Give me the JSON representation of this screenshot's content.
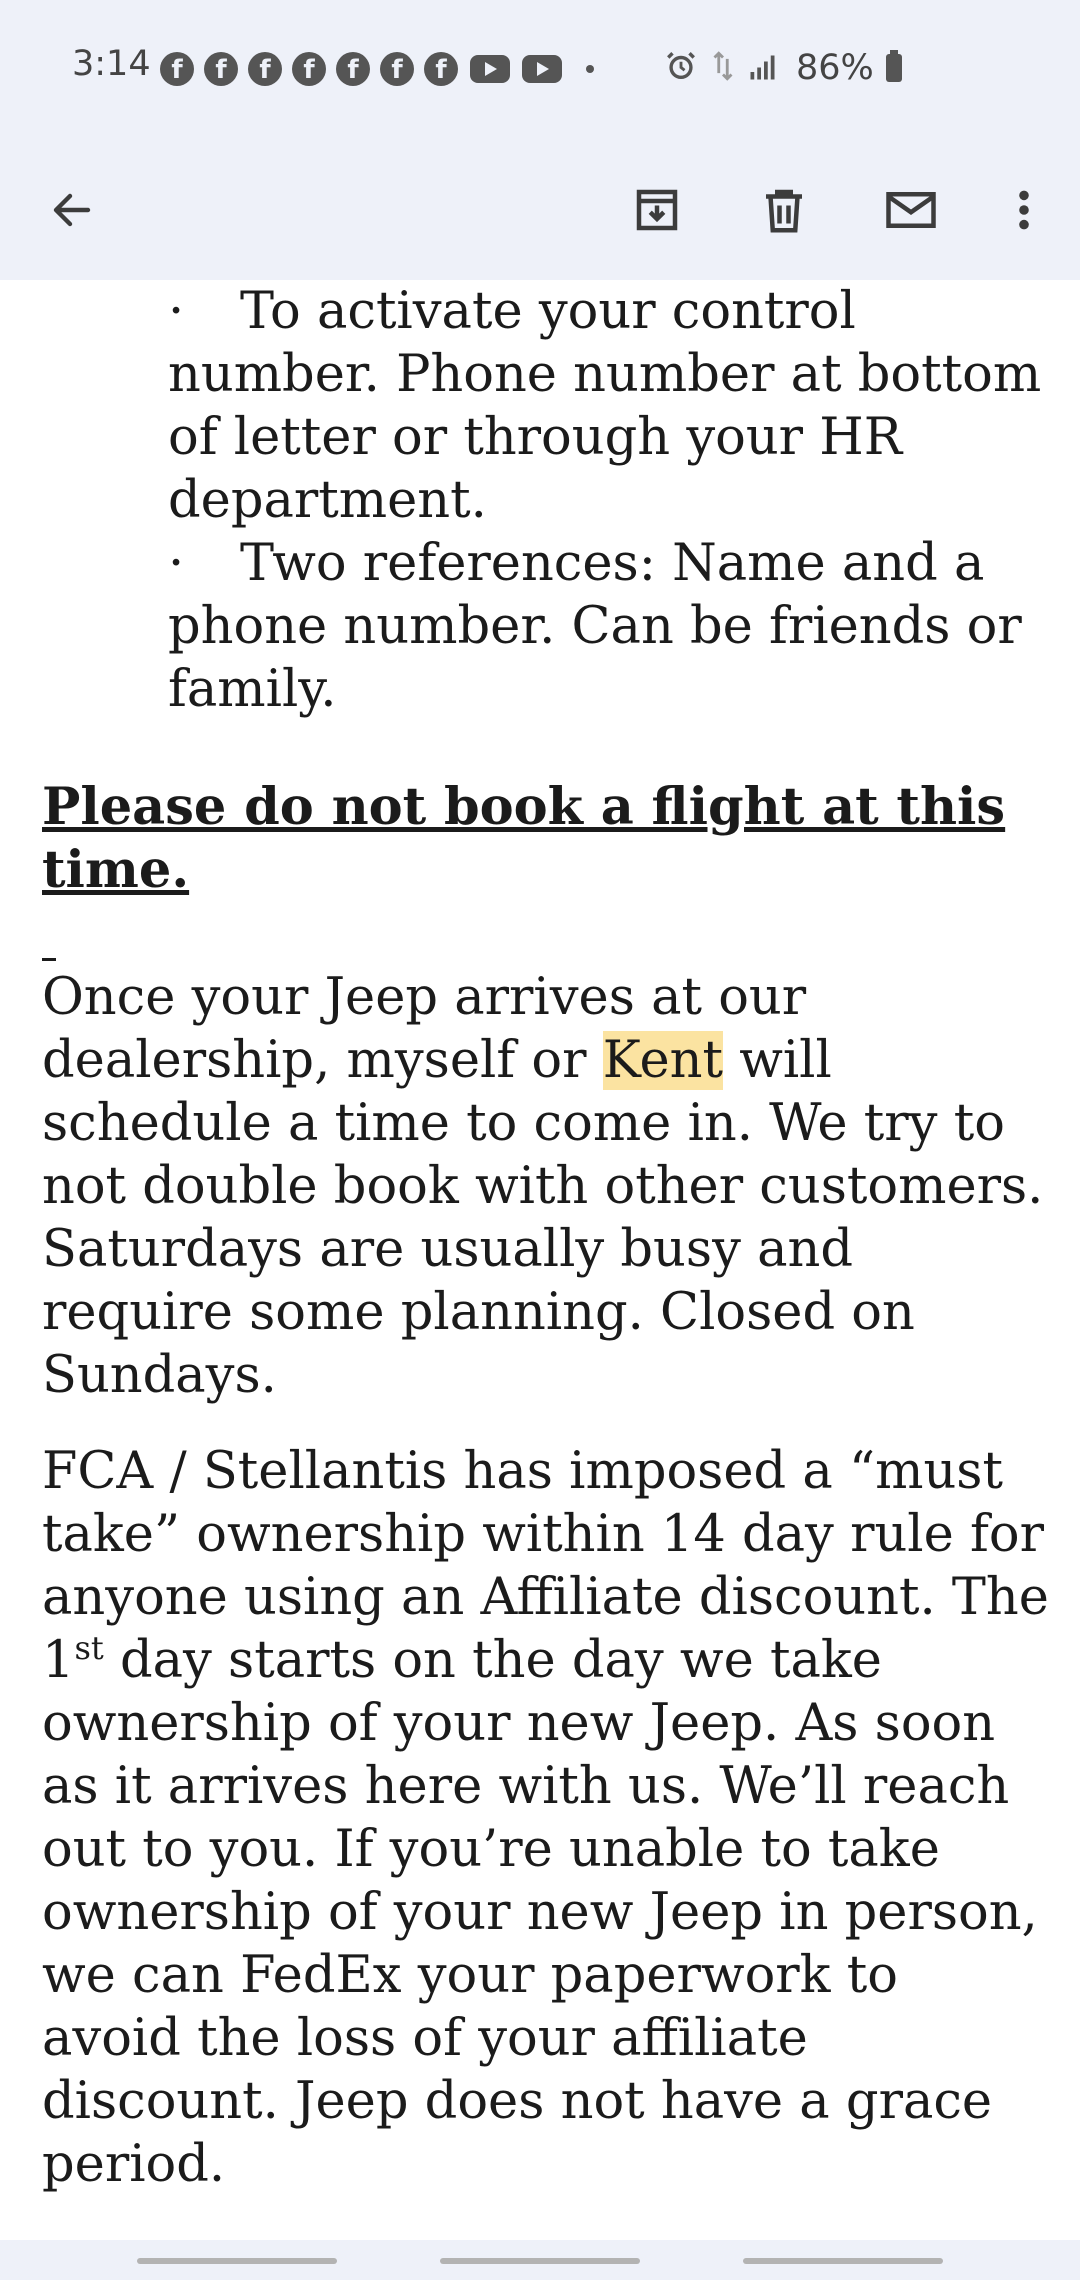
{
  "status_bar": {
    "time": "3:14",
    "battery": "86%",
    "notification_icons": [
      "facebook-icon",
      "facebook-icon",
      "facebook-icon",
      "facebook-icon",
      "facebook-icon",
      "facebook-icon",
      "facebook-icon",
      "youtube-icon",
      "youtube-icon",
      "dot-icon"
    ],
    "system_icons": [
      "alarm-icon",
      "data-transfer-icon",
      "signal-icon",
      "battery-icon"
    ]
  },
  "app_bar": {
    "icons": [
      "back-arrow-icon",
      "archive-icon",
      "delete-icon",
      "mark-unread-icon",
      "more-options-icon"
    ]
  },
  "email": {
    "bullets": [
      {
        "mark": "·",
        "text": "To activate your control number. Phone number at bottom of letter or through your HR department."
      },
      {
        "mark": "·",
        "text": "Two references: Name and a phone number. Can be friends or family."
      }
    ],
    "notice": "Please do not book a flight at this time.",
    "para1_before": "Once your Jeep arrives at our dealership, myself or ",
    "para1_highlight": "Kent",
    "para1_after": " will schedule a time to come in. We try to not double book with other customers. Saturdays are usually busy and require some planning. Closed on Sundays.",
    "para2_part1": "FCA / Stellantis has imposed a “must take” ownership within 14 day rule for anyone using an Affiliate discount. The 1",
    "para2_sup": "st",
    "para2_part2": " day starts on the day we take ownership of your new Jeep. As soon as it arrives here with us. We’ll reach out to you. If you’re unable to take ownership of your new Jeep in person, we can FedEx your paperwork to avoid the loss of your affiliate discount. Jeep does not have a grace period."
  },
  "colors": {
    "chrome_bg": "#eef1f9",
    "highlight": "#fbe3a1",
    "text": "#1b1b1b"
  }
}
